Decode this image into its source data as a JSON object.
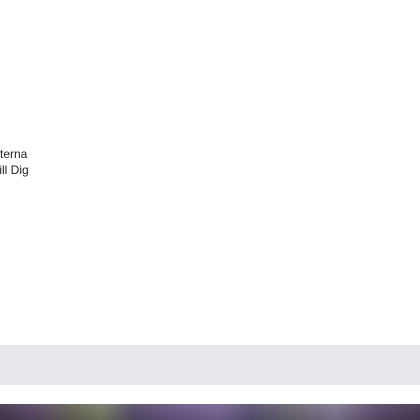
{
  "main": {
    "lines": [
      "terna",
      "till Dig"
    ]
  },
  "colors": {
    "band": "#e8e8ec",
    "text": "#222222",
    "background": "#ffffff"
  }
}
